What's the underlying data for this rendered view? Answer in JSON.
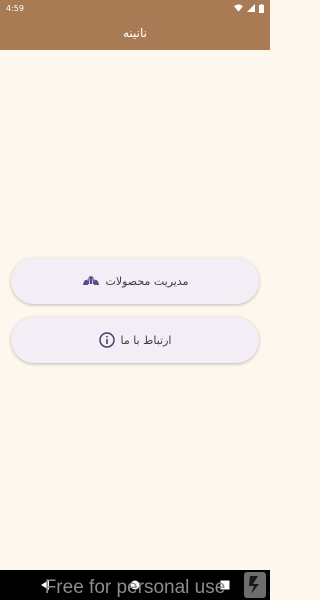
{
  "status_bar": {
    "time": "4:59"
  },
  "app_bar": {
    "title": "نانینه"
  },
  "menu": {
    "products_label": "مدیریت محصولات",
    "contact_label": "ارتباط با ما"
  },
  "watermark": {
    "text": "Free for personal use"
  },
  "colors": {
    "app_bar": "#a87b54",
    "background": "#fdf7ee",
    "card": "#f3edf5",
    "icon": "#5a4b8a"
  }
}
